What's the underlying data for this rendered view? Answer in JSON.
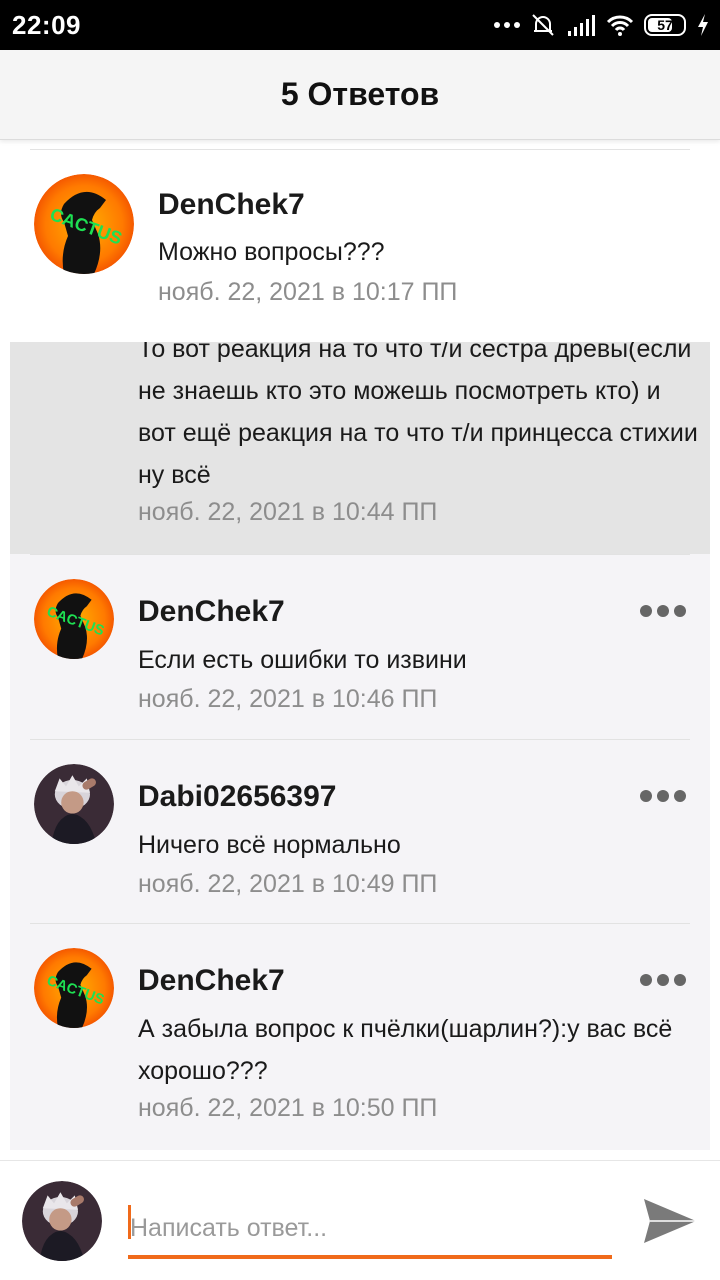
{
  "status_bar": {
    "time": "22:09",
    "battery": "57"
  },
  "header": {
    "title": "5 Ответов"
  },
  "original_comment": {
    "author": "DenChek7",
    "text": "Можно вопросы???",
    "date": "нояб. 22, 2021 в 10:17 ПП"
  },
  "replies": [
    {
      "author": "",
      "text": "То вот реакция на то что т/и сестра древы(если не знаешь кто это можешь посмотреть кто) и вот ещё реакция на то что т/и принцесса стихии ну всё",
      "date": "нояб. 22, 2021 в 10:44 ПП"
    },
    {
      "author": "DenChek7",
      "text": "Если есть ошибки то извини",
      "date": "нояб. 22, 2021 в 10:46 ПП"
    },
    {
      "author": "Dabi02656397",
      "text": "Ничего всё нормально",
      "date": "нояб. 22, 2021 в 10:49 ПП"
    },
    {
      "author": "DenChek7",
      "text": "А забыла вопрос к пчёлки(шарлин?):у вас всё хорошо???",
      "date": "нояб. 22, 2021 в 10:50 ПП"
    }
  ],
  "composer": {
    "placeholder": "Написать ответ..."
  },
  "colors": {
    "accent": "#f06a1a",
    "reply_bg": "#f5f4f7",
    "highlight_bg": "#e4e4e4"
  }
}
